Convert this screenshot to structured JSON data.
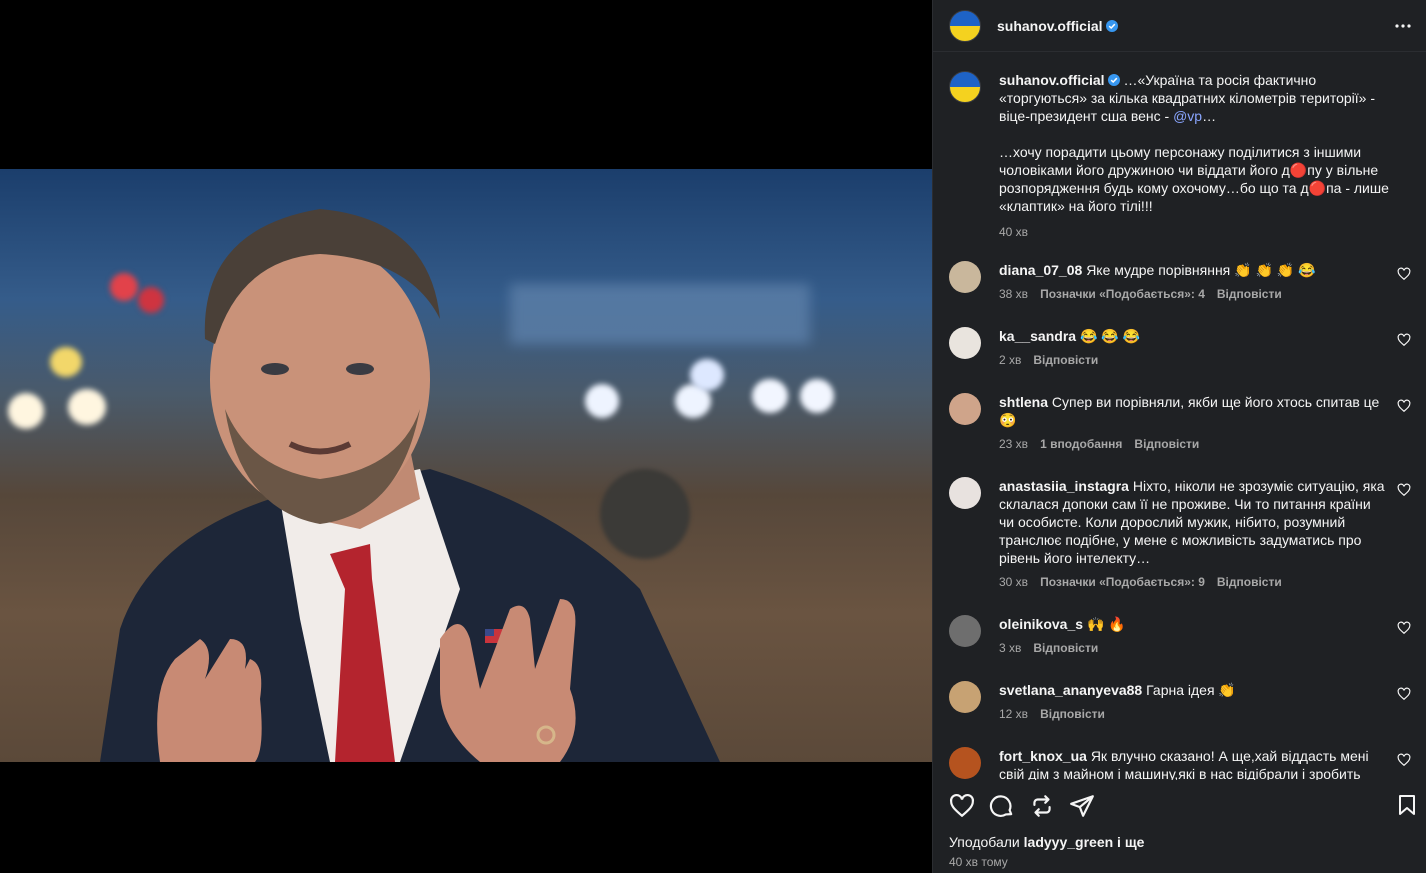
{
  "post": {
    "author": "suhanov.official",
    "caption_mention": "@vp",
    "caption_part1": "…«Україна та росія фактично «торгуються» за кілька квадратних кілометрів території» - віце-президент сша венс - ",
    "caption_part1_end": "…",
    "caption_part2": "…хочу порадити цьому персонажу поділитися з іншими чоловіками його дружиною чи віддати його д🔴пу у вільне розпорядження будь кому охочому…бо що та д🔴па - лише «клаптик» на його тілі!!!",
    "caption_time": "40 хв",
    "liked_by_prefix": "Уподобали ",
    "liked_by_user": "ladyyy_green",
    "liked_by_suffix": " і ще",
    "posted_ago": "40 хв тому",
    "image_alt": "Photo of a man in a suit gesturing at night"
  },
  "comments": [
    {
      "user": "diana_07_08",
      "text": "Яке мудре порівняння 👏 👏 👏 😂",
      "time": "38 хв",
      "likes": "Позначки «Подобається»: 4",
      "reply": "Відповісти",
      "avatar_color": "#c9b79c"
    },
    {
      "user": "ka__sandra",
      "text": "😂 😂 😂",
      "time": "2 хв",
      "likes": "",
      "reply": "Відповісти",
      "avatar_color": "#e9e4de"
    },
    {
      "user": "shtlena",
      "text": "Супер ви порівняли, якби ще його хтось спитав це 😳",
      "time": "23 хв",
      "likes": "1 вподобання",
      "reply": "Відповісти",
      "avatar_color": "#cfa48a"
    },
    {
      "user": "anastasiia_instagra",
      "text": "Ніхто, ніколи не зрозуміє ситуацію, яка склалася допоки сам її не проживе. Чи то питання країни чи особисте. Коли дорослий мужик, нібито, розумний транслює подібне, у мене є можливість задуматись про рівень його інтелекту…",
      "time": "30 хв",
      "likes": "Позначки «Подобається»: 9",
      "reply": "Відповісти",
      "avatar_color": "#e8e2df"
    },
    {
      "user": "oleinikova_s",
      "text": "🙌 🔥",
      "time": "3 хв",
      "likes": "",
      "reply": "Відповісти",
      "avatar_color": "#6e6e6e"
    },
    {
      "user": "svetlana_ananyeva88",
      "text": "Гарна ідея 👏",
      "time": "12 хв",
      "likes": "",
      "reply": "Відповісти",
      "avatar_color": "#c7a273"
    },
    {
      "user": "fort_knox_ua",
      "text": "Як влучно сказано! А ще,хай віддасть мені свій дім з майном і машину,які в нас відібрали і зробить мені",
      "time": "",
      "likes": "",
      "reply": "",
      "avatar_color": "#b5531f"
    }
  ],
  "colors": {
    "accent": "#0095f6",
    "verified": "#3797f0",
    "panel_bg": "#1f2124"
  },
  "icons": [
    "more-icon",
    "verified-icon",
    "heart-icon",
    "comment-icon",
    "repost-icon",
    "share-icon",
    "bookmark-icon"
  ]
}
